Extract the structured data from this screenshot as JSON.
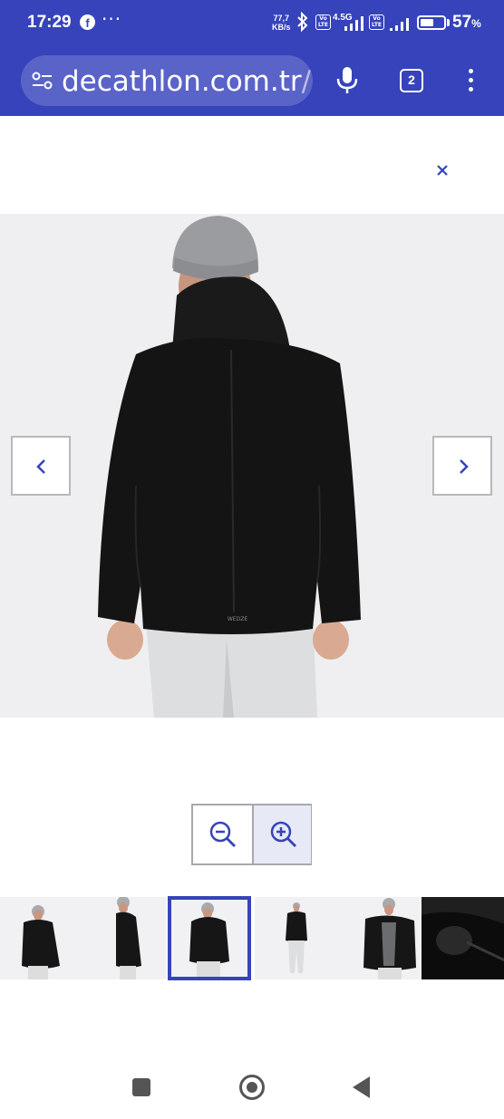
{
  "status_bar": {
    "time": "17:29",
    "app_icon": "facebook-icon",
    "more": "···",
    "speed_value": "77,7",
    "speed_unit": "KB/s",
    "volte_label": "Vo LTE",
    "network_type": "4.5G",
    "battery_percent_value": "57",
    "battery_percent_sign": "%",
    "battery_level": 0.57
  },
  "browser": {
    "url_main": "decathlon.com.tr",
    "url_rest": "/p",
    "tab_count": "2",
    "theme_color": "#3643ba",
    "icons": [
      "tune-icon",
      "mic-icon",
      "tabs-icon",
      "kebab-menu-icon"
    ]
  },
  "viewer": {
    "close_icon": "close-icon",
    "prev_icon": "chevron-left-icon",
    "next_icon": "chevron-right-icon",
    "zoom_out_icon": "zoom-out-icon",
    "zoom_in_icon": "zoom-in-icon",
    "accent_color": "#3643ba",
    "jacket_logo": "WEDZE",
    "active_thumbnail_index": 2,
    "thumbnails": [
      "thumbnail-front-view",
      "thumbnail-side-view",
      "thumbnail-back-view",
      "thumbnail-full-body-view",
      "thumbnail-open-jacket-view",
      "thumbnail-sleeve-detail-view"
    ]
  },
  "system_nav": {
    "icons": [
      "recents-icon",
      "home-icon",
      "back-icon"
    ]
  }
}
